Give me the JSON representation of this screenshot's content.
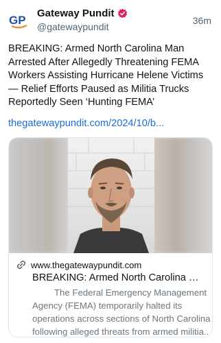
{
  "account": {
    "avatar_text": "GP",
    "display_name": "Gateway Pundit",
    "handle": "@gatewaypundit",
    "time_ago": "36m",
    "verified_icon": "verified-badge-icon"
  },
  "post": {
    "text": "BREAKING: Armed North Carolina Man Arrested After Allegedly Threatening FEMA Workers Assisting Hurricane Helene Victims — Relief Efforts Paused as Militia Trucks Reportedly Seen ‘Hunting FEMA’",
    "link_text": "thegatewaypundit.com/2024/10/b..."
  },
  "link_card": {
    "domain": "www.thegatewaypundit.com",
    "title": "BREAKING: Armed North Carolina Ma...",
    "description": "The Federal Emergency Management Agency (FEMA) temporarily halted its operations across sections of North Carolina following alleged threats from armed militia...",
    "link_icon": "link-icon",
    "image": "mugshot-photo"
  },
  "colors": {
    "link": "#1d6fd8",
    "text": "#0f1419",
    "muted": "#536471",
    "avatar_blue": "#1f4fa8",
    "avatar_orange": "#e8882a",
    "verified": "#e0245e"
  }
}
